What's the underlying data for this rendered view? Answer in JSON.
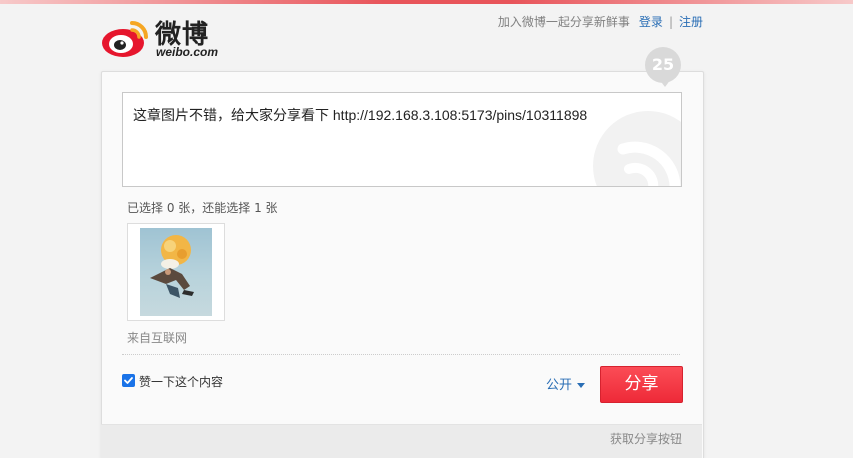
{
  "brand": {
    "name": "微博",
    "domain": "weibo.com",
    "primary_color": "#e6162d",
    "accent_color": "#f5a623"
  },
  "header": {
    "tagline": "加入微博一起分享新鲜事",
    "login_label": "登录",
    "separator": "|",
    "register_label": "注册"
  },
  "composer": {
    "char_count": "25",
    "text": "这章图片不错，给大家分享看下 http://192.168.3.108:5173/pins/10311898"
  },
  "images": {
    "selection_info": "已选择 0 张，还能选择 1 张",
    "source_label": "来自互联网"
  },
  "actions": {
    "like_label": "赞一下这个内容",
    "like_checked": true,
    "privacy_label": "公开",
    "share_label": "分享"
  },
  "footer": {
    "get_button_label": "获取分享按钮"
  }
}
